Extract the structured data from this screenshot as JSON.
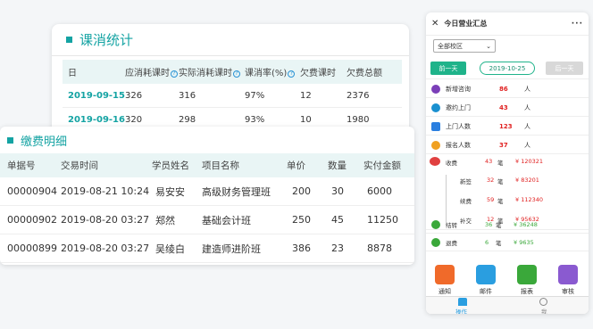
{
  "card1": {
    "title": "课消统计",
    "headers": [
      "日",
      "应消耗课时",
      "实际消耗课时",
      "课消率(%)",
      "欠费课时",
      "欠费总额"
    ],
    "rows": [
      [
        "2019-09-15",
        "326",
        "316",
        "97%",
        "12",
        "2376"
      ],
      [
        "2019-09-16",
        "320",
        "298",
        "93%",
        "10",
        "1980"
      ]
    ]
  },
  "card2": {
    "title": "缴费明细",
    "headers": [
      "单据号",
      "交易时间",
      "学员姓名",
      "项目名称",
      "单价",
      "数量",
      "实付金额"
    ],
    "rows": [
      [
        "00000904",
        "2019-08-21 10:24",
        "易安安",
        "高级财务管理班",
        "200",
        "30",
        "6000"
      ],
      [
        "00000902",
        "2019-08-20 03:27",
        "郑然",
        "基础会计班",
        "250",
        "45",
        "11250"
      ],
      [
        "00000899",
        "2019-08-20 03:27",
        "吴绫白",
        "建造师进阶班",
        "386",
        "23",
        "8878"
      ]
    ]
  },
  "phone": {
    "title": "今日营业汇总",
    "close": "✕",
    "more": "···",
    "campus": "全部校区",
    "prev_day": "前一天",
    "date": "2019-10-25",
    "next_day": "后一天",
    "stats": [
      {
        "label": "新增咨询",
        "value": "86",
        "unit": "人"
      },
      {
        "label": "邀约上门",
        "value": "43",
        "unit": "人"
      },
      {
        "label": "上门人数",
        "value": "123",
        "unit": "人"
      },
      {
        "label": "报名人数",
        "value": "37",
        "unit": "人"
      }
    ],
    "income": {
      "label": "收费",
      "count": "43",
      "count_unit": "笔",
      "amount": "¥ 120321"
    },
    "income_sub": [
      {
        "label": "新签",
        "count": "32",
        "count_unit": "笔",
        "amount": "¥ 83201"
      },
      {
        "label": "续费",
        "count": "59",
        "count_unit": "笔",
        "amount": "¥ 112340"
      },
      {
        "label": "补交",
        "count": "12",
        "count_unit": "笔",
        "amount": "¥ 95632"
      }
    ],
    "settle": {
      "label": "结转",
      "count": "36",
      "count_unit": "笔",
      "amount": "¥ 36248"
    },
    "refund": {
      "label": "退费",
      "count": "6",
      "count_unit": "笔",
      "amount": "¥ 9635"
    },
    "apps": [
      "通知",
      "邮件",
      "报表",
      "审核"
    ],
    "bottom_tabs": [
      "操作",
      "我"
    ]
  }
}
